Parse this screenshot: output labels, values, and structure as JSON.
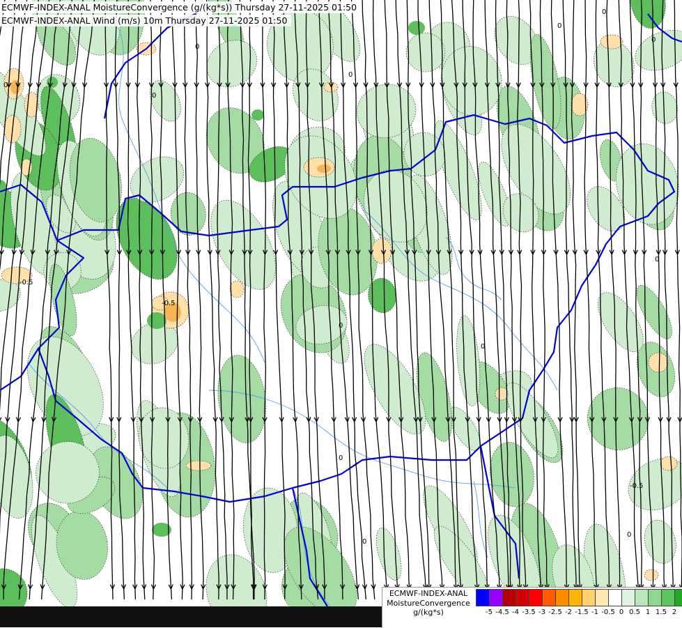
{
  "header": {
    "line1": "ECMWF-INDEX-ANAL MoistureConvergence (g/(kg*s)) Thursday 27-11-2025 01:50",
    "line2": "ECMWF-INDEX-ANAL Wind (m/s) 10m Thursday 27-11-2025 01:50"
  },
  "legend": {
    "model": "ECMWF-INDEX-ANAL",
    "parameter": "MoistureConvergence",
    "unit": "g/(kg*s)",
    "colors": [
      "#0000ff",
      "#9900ff",
      "#b40000",
      "#d20000",
      "#ff0000",
      "#ff5a00",
      "#ff8c00",
      "#ffb400",
      "#ffd070",
      "#ffe8b0",
      "#ffffff",
      "#dff3df",
      "#b8e6b8",
      "#8fd68f",
      "#5cc45c",
      "#22aa22"
    ],
    "labels": [
      "-5",
      "-4.5",
      "-4",
      "-3.5",
      "-3",
      "-2.5",
      "-2",
      "-1.5",
      "-1",
      "-0.5",
      "0",
      "0.5",
      "1",
      "1.5",
      "2"
    ]
  },
  "contour_labels": [
    "0",
    "0",
    "0",
    "0",
    "0",
    "0",
    "-0.5",
    "-0.5",
    "0",
    "0",
    "0",
    "0",
    "0",
    "0",
    "-0.5",
    "0"
  ],
  "map_colors": {
    "land": "#ffffff",
    "convergence_light": "#cfeccf",
    "convergence_mid": "#a4dca4",
    "convergence_strong": "#5cbf5c",
    "divergence_light": "#ffe0a8",
    "divergence_mid": "#f5b455",
    "border": "#0000dd",
    "river": "#5aa0e6",
    "streamline": "#000000",
    "contour": "#222222"
  }
}
